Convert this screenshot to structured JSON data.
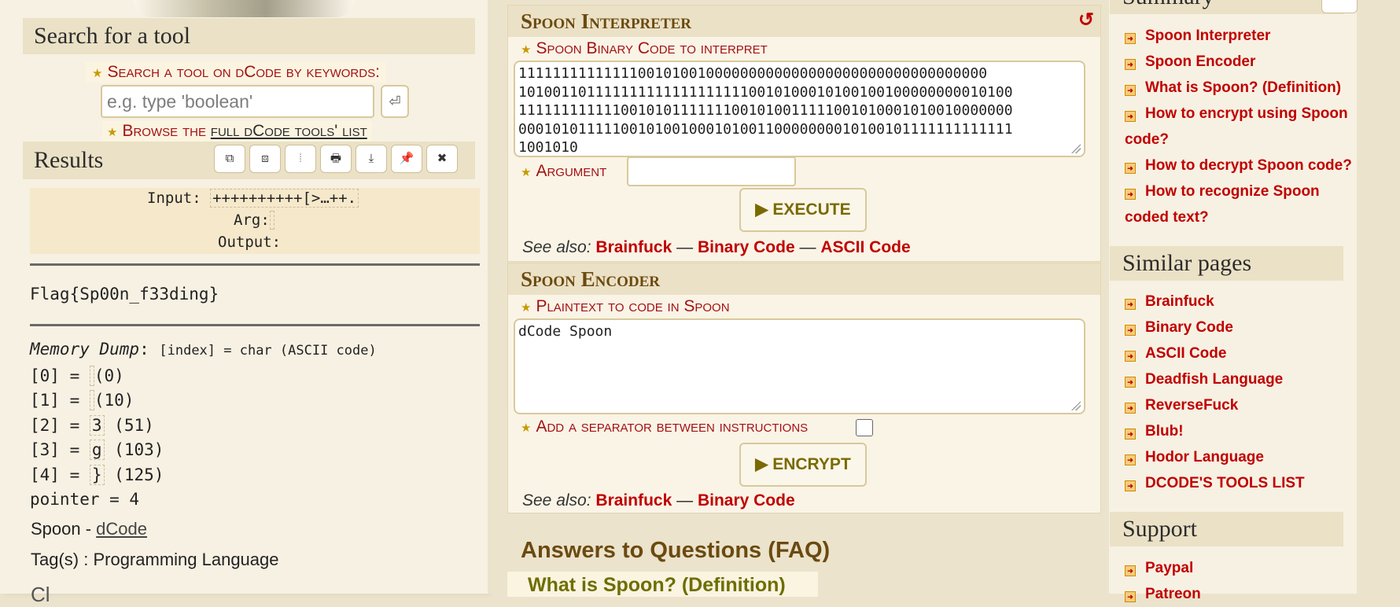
{
  "search": {
    "heading": "Search for a tool",
    "label": "Search a tool on dCode by keywords:",
    "placeholder": "e.g. type 'boolean'",
    "go_icon": "⏎",
    "browse_prefix": "Browse the ",
    "browse_link": "full dCode tools' list"
  },
  "results": {
    "heading": "Results",
    "tools": [
      "copy-icon",
      "copy-all-icon",
      "split-icon",
      "print-icon",
      "download-icon",
      "pin-icon",
      "close-icon"
    ],
    "input_label": "Input:",
    "input_value": "++++++++++[>…++.",
    "arg_label": "Arg:",
    "arg_value": "",
    "output_label": "Output:",
    "output_value": "",
    "flag": "Flag{Sp00n_f33ding}",
    "memory_title": "Memory Dump",
    "memory_note": "[index] = char (ASCII code)",
    "memory": [
      {
        "index": "[0] = ",
        "char": "",
        "code": "(0)"
      },
      {
        "index": "[1] = ",
        "char": "",
        "code": "(10)"
      },
      {
        "index": "[2] = ",
        "char": "3",
        "code": "(51)"
      },
      {
        "index": "[3] = ",
        "char": "g",
        "code": "(103)"
      },
      {
        "index": "[4] = ",
        "char": "}",
        "code": "(125)"
      }
    ],
    "pointer": "pointer = 4",
    "credit_prefix": "Spoon - ",
    "credit_link": "dCode",
    "tags": "Tag(s) : Programming Language",
    "cutoff": "Cl"
  },
  "interpreter": {
    "title": "Spoon Interpreter",
    "reset_icon": "↺",
    "code_label": "Spoon Binary Code to interpret",
    "code_lines": [
      "1111111111111100101001000000000000000000000000000000000",
      "1010011011111111111111111110010100010100100100000000010100",
      "1111111111110010101111111001010011111001010001010010000000",
      "0001010111110010100100010100110000000010100101111111111111",
      "1001010"
    ],
    "argument_label": "Argument",
    "argument_value": "",
    "execute_label": "▶ EXECUTE",
    "see_also_label": "See also:",
    "see_also": [
      "Brainfuck",
      "Binary Code",
      "ASCII Code"
    ],
    "sep": " — "
  },
  "encoder": {
    "title": "Spoon Encoder",
    "plaintext_label": "Plaintext to code in Spoon",
    "plaintext_value": "dCode Spoon",
    "separator_label": "Add a separator between instructions",
    "separator_checked": false,
    "encrypt_label": "▶ ENCRYPT",
    "see_also_label": "See also:",
    "see_also": [
      "Brainfuck",
      "Binary Code"
    ],
    "sep": " — "
  },
  "faq": {
    "title": "Answers to Questions (FAQ)",
    "first_item": "What is Spoon? (Definition)"
  },
  "summary": {
    "heading": "Summary",
    "items": [
      "Spoon Interpreter",
      "Spoon Encoder",
      "What is Spoon? (Definition)",
      "How to encrypt using Spoon code?",
      "How to decrypt Spoon code?",
      "How to recognize Spoon coded text?"
    ]
  },
  "similar": {
    "heading": "Similar pages",
    "items": [
      "Brainfuck",
      "Binary Code",
      "ASCII Code",
      "Deadfish Language",
      "ReverseFuck",
      "Blub!",
      "Hodor Language",
      "DCODE'S TOOLS LIST"
    ]
  },
  "support": {
    "heading": "Support",
    "items": [
      "Paypal",
      "Patreon"
    ]
  },
  "colors": {
    "link_red": "#c00000",
    "label_red": "#a31014",
    "heading_brown": "#6b4a10",
    "button_olive": "#7a6a00"
  }
}
